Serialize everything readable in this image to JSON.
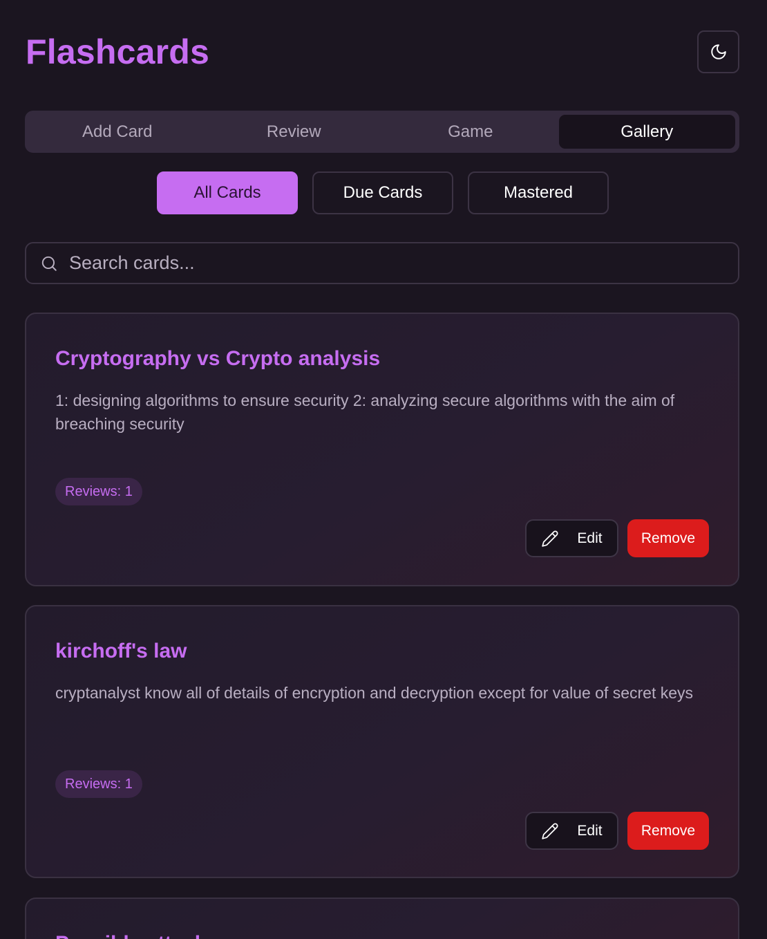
{
  "header": {
    "title": "Flashcards",
    "theme_toggle_icon": "moon-icon"
  },
  "tabs": [
    {
      "label": "Add Card",
      "active": false
    },
    {
      "label": "Review",
      "active": false
    },
    {
      "label": "Game",
      "active": false
    },
    {
      "label": "Gallery",
      "active": true
    }
  ],
  "filters": [
    {
      "label": "All Cards",
      "active": true
    },
    {
      "label": "Due Cards",
      "active": false
    },
    {
      "label": "Mastered",
      "active": false
    }
  ],
  "search": {
    "placeholder": "Search cards...",
    "value": "",
    "icon": "search-icon"
  },
  "cards": [
    {
      "title": "Cryptography vs Crypto analysis",
      "body": "1: designing algorithms to ensure security 2: analyzing secure algorithms with the aim of breaching security",
      "badge": "Reviews: 1",
      "edit_label": "Edit",
      "remove_label": "Remove"
    },
    {
      "title": "kirchoff's law",
      "body": "cryptanalyst know all of details of encryption and decryption except for value of secret keys",
      "badge": "Reviews: 1",
      "edit_label": "Edit",
      "remove_label": "Remove"
    },
    {
      "title": "Possible attacks"
    }
  ],
  "colors": {
    "accent": "#c66df1",
    "danger": "#dc1c1c",
    "background": "#1b1520"
  }
}
